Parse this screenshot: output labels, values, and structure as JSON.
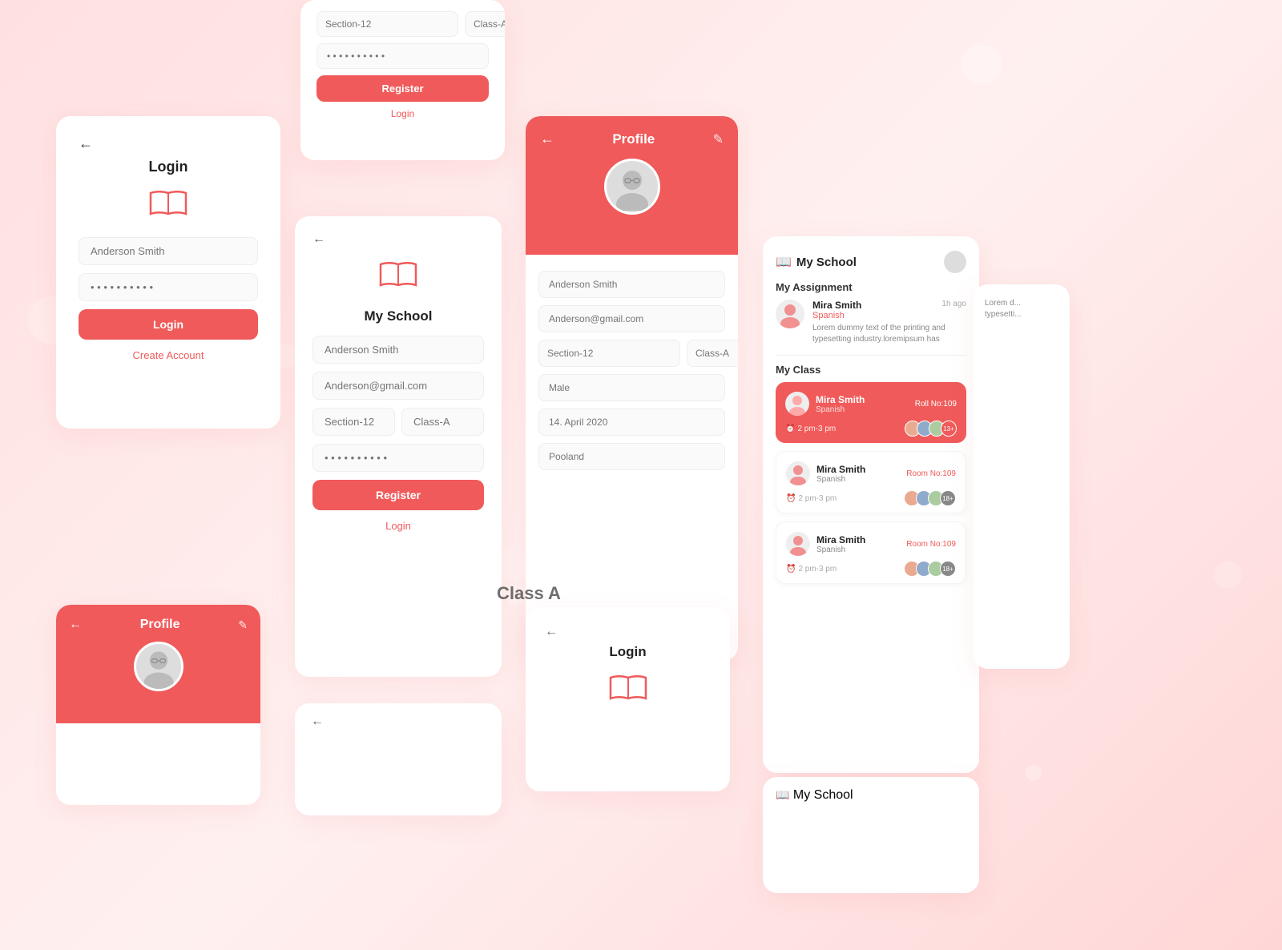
{
  "bg": {
    "color": "#fde8e8"
  },
  "login_main": {
    "title": "Login",
    "back": "←",
    "name_placeholder": "Anderson Smith",
    "password_placeholder": "• • • • • • • • • •",
    "button_label": "Login",
    "create_account": "Create Account"
  },
  "register_top": {
    "section_placeholder": "Section-12",
    "class_placeholder": "Class-A",
    "password_placeholder": "• • • • • • • • • •",
    "button_label": "Register",
    "login_link": "Login"
  },
  "myschool_register": {
    "back": "←",
    "title": "My School",
    "name_placeholder": "Anderson Smith",
    "email_placeholder": "Anderson@gmail.com",
    "section_placeholder": "Section-12",
    "class_placeholder": "Class-A",
    "password_placeholder": "• • • • • • • • • •",
    "button_label": "Register",
    "login_link": "Login"
  },
  "profile_main": {
    "title": "Profile",
    "back": "←",
    "edit_icon": "✎",
    "name_placeholder": "Anderson Smith",
    "email_placeholder": "Anderson@gmail.com",
    "section_placeholder": "Section-12",
    "class_placeholder": "Class-A",
    "gender_placeholder": "Male",
    "date_placeholder": "14. April 2020",
    "location_placeholder": "Pooland"
  },
  "dashboard": {
    "title": "My School",
    "assignment_title": "My Assignment",
    "myclass_title": "My Class",
    "assignment_items": [
      {
        "name": "Mira Smith",
        "subject": "Spanish",
        "time": "1h ago",
        "desc": "Lorem dummy text of the printing and typesetting industry.loremipsum has"
      }
    ],
    "class_items": [
      {
        "name": "Mira Smith",
        "subject": "Spanish",
        "badge": "Roll No:109",
        "time": "2 pm-3 pm",
        "avatars_more": "13+",
        "active": true
      },
      {
        "name": "Mira Smith",
        "subject": "Spanish",
        "badge": "Room No:109",
        "time": "2 pm-3 pm",
        "avatars_more": "18+",
        "active": false
      },
      {
        "name": "Mira Smith",
        "subject": "Spanish",
        "badge": "Room No:109",
        "time": "2 pm-3 pm",
        "avatars_more": "18+",
        "active": false
      }
    ]
  },
  "profile_bottom": {
    "title": "Profile",
    "back": "←",
    "edit_icon": "✎"
  },
  "login_bottom": {
    "title": "Login"
  },
  "partial_assignment": {
    "desc": "Lorem d... typesetti..."
  },
  "myschool_bottom": {
    "title": "My School"
  },
  "class_a_label": "Class A"
}
